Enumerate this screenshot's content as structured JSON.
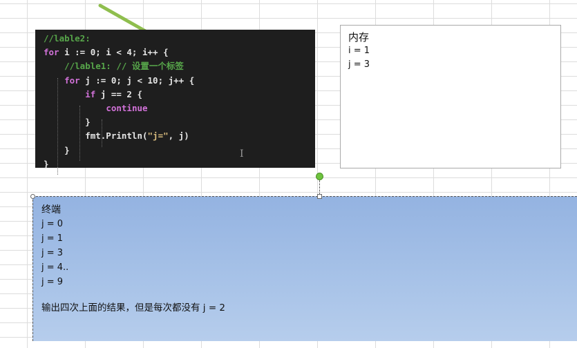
{
  "code": {
    "lines": [
      [
        {
          "t": "//lable2:",
          "c": "c"
        }
      ],
      [
        {
          "t": "for",
          "c": "k"
        },
        {
          "t": " i := 0; i < 4; i++ {",
          "c": "p"
        }
      ],
      [
        {
          "t": "    //lable1: // 设置一个标签",
          "c": "c"
        }
      ],
      [
        {
          "t": "    ",
          "c": "p"
        },
        {
          "t": "for",
          "c": "k"
        },
        {
          "t": " j := 0; j < 10; j++ {",
          "c": "p"
        }
      ],
      [
        {
          "t": "        ",
          "c": "p"
        },
        {
          "t": "if",
          "c": "k"
        },
        {
          "t": " j == 2 {",
          "c": "p"
        }
      ],
      [
        {
          "t": "            ",
          "c": "p"
        },
        {
          "t": "continue",
          "c": "k"
        }
      ],
      [
        {
          "t": "        }",
          "c": "p"
        }
      ],
      [
        {
          "t": "        fmt.Println(",
          "c": "p"
        },
        {
          "t": "\"j=\"",
          "c": "s"
        },
        {
          "t": ", j)",
          "c": "p"
        }
      ],
      [
        {
          "t": "    }",
          "c": "p"
        }
      ],
      [
        {
          "t": "}",
          "c": "p"
        }
      ]
    ]
  },
  "memory": {
    "title": "内存",
    "lines": [
      "i = 1",
      "j = 3"
    ]
  },
  "terminal": {
    "title": "终端",
    "lines": [
      "j = 0",
      "j = 1",
      "j = 3",
      "j = 4..",
      "j = 9"
    ],
    "note": "输出四次上面的结果，但是每次都没有 j = 2"
  },
  "colors": {
    "code_bg": "#1e1e1e",
    "comment": "#57a64a",
    "keyword": "#d272d9",
    "string": "#d7ba7d",
    "arrow": "#8fbe4e",
    "terminal_bg": "#a8c3e8"
  }
}
